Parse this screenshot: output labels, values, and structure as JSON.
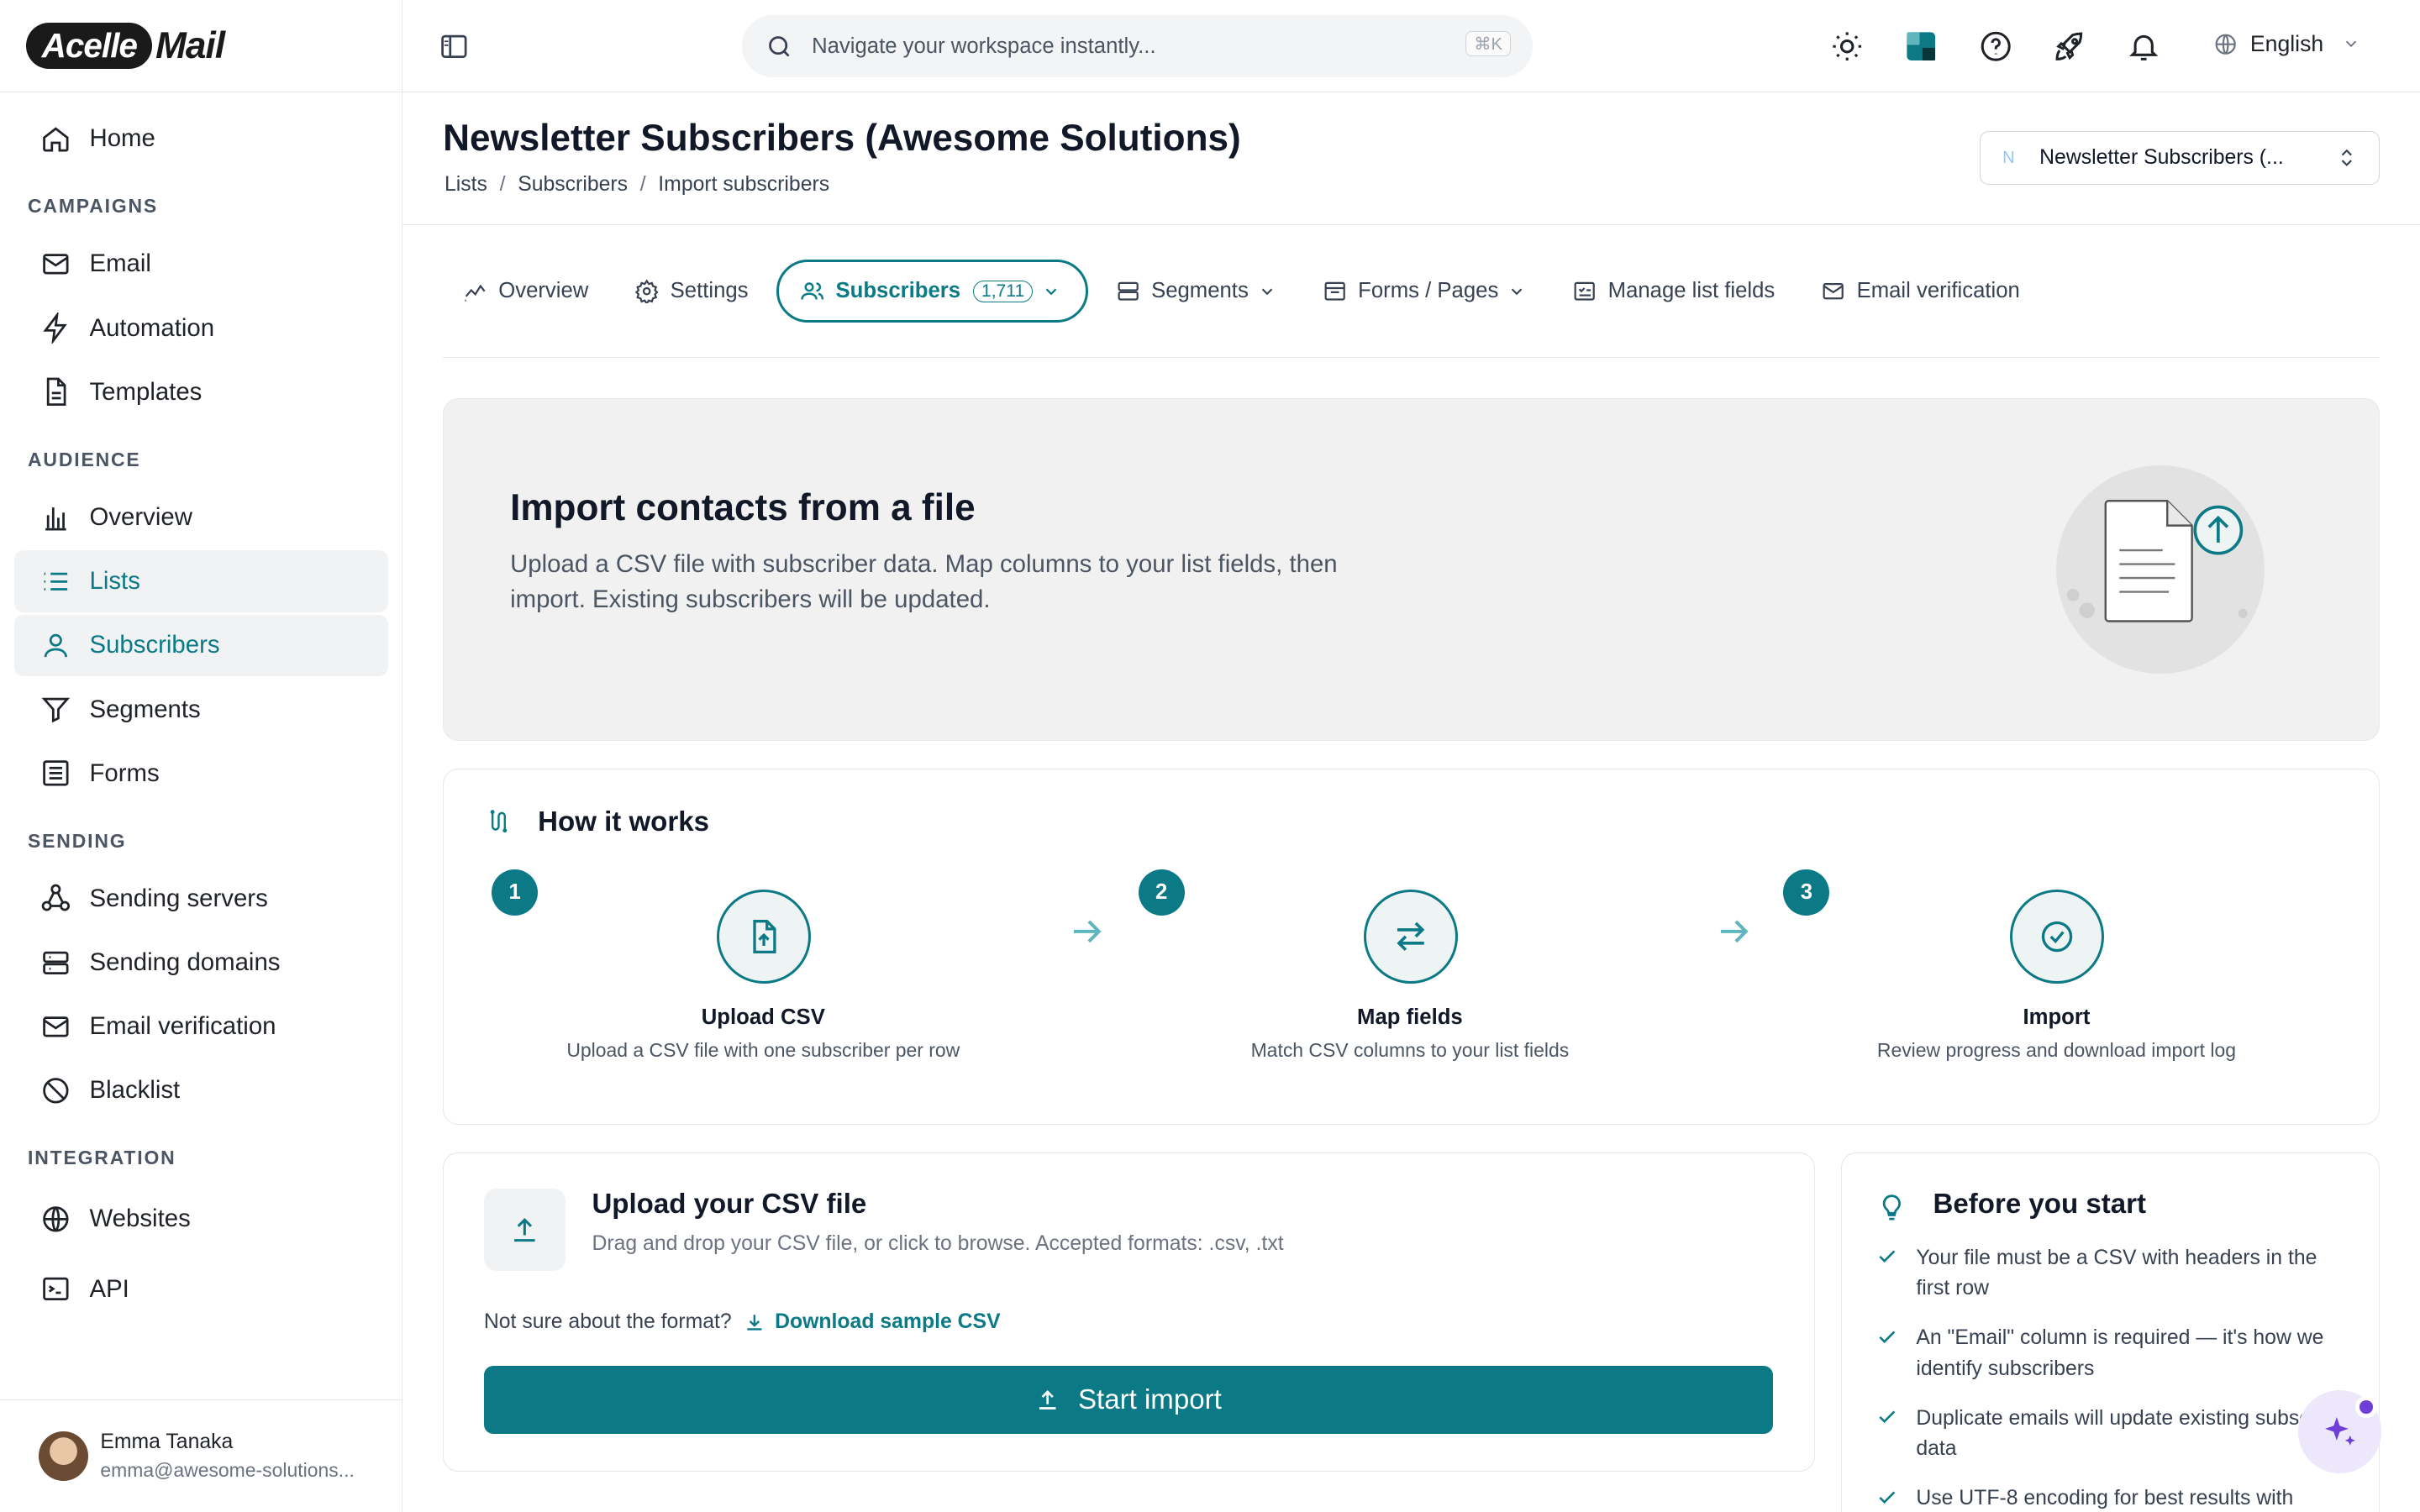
{
  "brand": {
    "logo_left": "Acelle",
    "logo_right": "Mail"
  },
  "sidebar": {
    "home": "Home",
    "sections": {
      "campaigns": "CAMPAIGNS",
      "audience": "AUDIENCE",
      "sending": "SENDING",
      "integration": "INTEGRATION"
    },
    "campaigns": [
      "Email",
      "Automation",
      "Templates"
    ],
    "audience": [
      "Overview",
      "Lists",
      "Subscribers",
      "Segments",
      "Forms"
    ],
    "sending": [
      "Sending servers",
      "Sending domains",
      "Email verification",
      "Blacklist"
    ],
    "integration": [
      "Websites",
      "API"
    ],
    "user": {
      "name": "Emma Tanaka",
      "email": "emma@awesome-solutions..."
    }
  },
  "topbar": {
    "search_placeholder": "Navigate your workspace instantly...",
    "shortcut": "⌘K",
    "language": "English"
  },
  "header": {
    "title": "Newsletter Subscribers (Awesome Solutions)",
    "breadcrumbs": [
      "Lists",
      "Subscribers",
      "Import subscribers"
    ],
    "list_select": {
      "initial": "N",
      "label": "Newsletter Subscribers (..."
    }
  },
  "tabs": {
    "overview": "Overview",
    "settings": "Settings",
    "subscribers": "Subscribers",
    "subscribers_count": "1,711",
    "segments": "Segments",
    "forms": "Forms / Pages",
    "fields": "Manage list fields",
    "verification": "Email verification"
  },
  "hero": {
    "title": "Import contacts from a file",
    "description": "Upload a CSV file with subscriber data. Map columns to your list fields, then import. Existing subscribers will be updated."
  },
  "how": {
    "title": "How it works",
    "steps": [
      {
        "num": "1",
        "label": "Upload CSV",
        "desc": "Upload a CSV file with one subscriber per row"
      },
      {
        "num": "2",
        "label": "Map fields",
        "desc": "Match CSV columns to your list fields"
      },
      {
        "num": "3",
        "label": "Import",
        "desc": "Review progress and download import log"
      }
    ]
  },
  "upload": {
    "title": "Upload your CSV file",
    "desc": "Drag and drop your CSV file, or click to browse. Accepted formats: .csv, .txt",
    "format_q": "Not sure about the format?",
    "download": "Download sample CSV",
    "start": "Start import"
  },
  "before": {
    "title": "Before you start",
    "items": [
      "Your file must be a CSV with headers in the first row",
      "An \"Email\" column is required — it's how we identify subscribers",
      "Duplicate emails will update existing subscriber data",
      "Use UTF-8 encoding for best results with"
    ]
  },
  "colors": {
    "accent": "#0b7a86",
    "hero_bg": "#f1f1f1",
    "fab": "#6d3fd8"
  }
}
